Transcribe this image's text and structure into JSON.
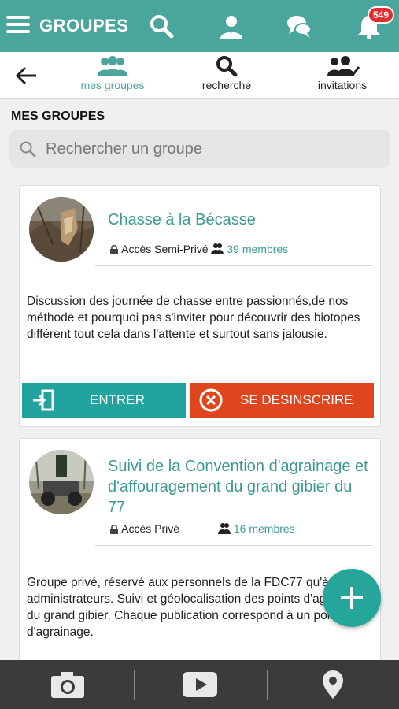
{
  "header": {
    "title": "GROUPES",
    "notification_count": "549",
    "icons": [
      "menu-icon",
      "search-icon",
      "contacts-icon",
      "chat-icon",
      "bell-icon"
    ]
  },
  "tabs": [
    {
      "label": "mes groupes",
      "icon": "groups-icon",
      "active": true
    },
    {
      "label": "recherche",
      "icon": "search-icon",
      "active": false
    },
    {
      "label": "invitations",
      "icon": "invitations-icon",
      "active": false
    }
  ],
  "section": {
    "title": "MES GROUPES",
    "search_placeholder": "Rechercher un groupe"
  },
  "groups": [
    {
      "name": "Chasse à la Bécasse",
      "access": "Accès Semi-Privé",
      "members": "39 membres",
      "description": "Discussion des journée de chasse entre passionnés,de nos méthode et pourquoi pas s'inviter pour découvrir des biotopes différent tout cela dans l'attente et surtout sans jalousie.",
      "enter_label": "ENTRER",
      "unsubscribe_label": "SE DESINSCRIRE"
    },
    {
      "name": "Suivi de la Convention d'agrainage et d'affouragement du grand gibier du 77",
      "access": "Accès Privé",
      "members": "16 membres",
      "description": "Groupe privé, réservé aux personnels de la FDC77 qu'à ses administrateurs. Suivi et géolocalisation des points d'agrainages du grand gibier. Chaque publication correspond à un point d'agrainage."
    }
  ],
  "bottom_bar": {
    "icons": [
      "camera-icon",
      "video-icon",
      "location-icon"
    ]
  },
  "colors": {
    "primary": "#4aa59c",
    "enter_button": "#21a3a0",
    "unsubscribe_button": "#e0461d",
    "badge": "#e52b2b",
    "bottom_bar": "#3b3b3b"
  }
}
